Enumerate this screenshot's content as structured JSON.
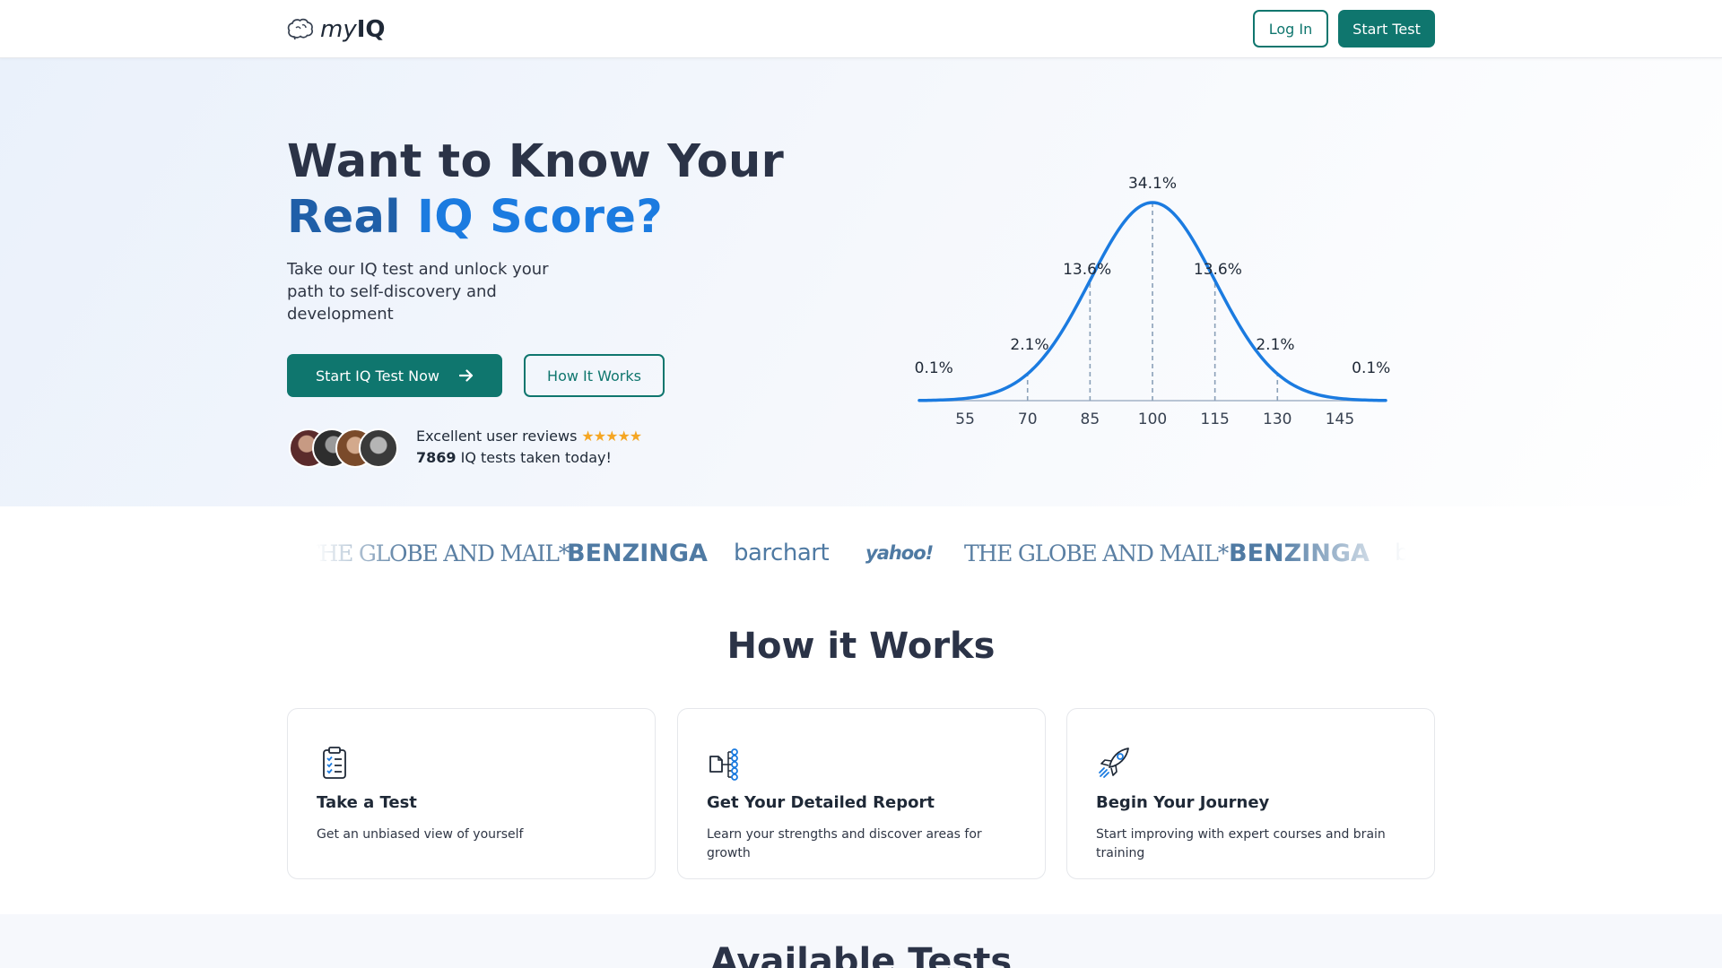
{
  "header": {
    "logo_my": "my",
    "logo_iq": "IQ",
    "login_label": "Log In",
    "start_label": "Start Test"
  },
  "hero": {
    "title_line1": "Want to Know Your",
    "title_real": "Real",
    "title_iqscore": "IQ Score?",
    "subtitle": "Take our IQ test and unlock your path to self-discovery and development",
    "primary_cta": "Start IQ Test Now",
    "secondary_cta": "How It Works",
    "reviews_text": "Excellent user reviews",
    "stars": "★★★★★",
    "rating": 5,
    "tests_count": "7869",
    "tests_text": "IQ tests taken today!"
  },
  "chart_data": {
    "type": "area",
    "x_ticks": [
      "55",
      "70",
      "85",
      "100",
      "115",
      "130",
      "145"
    ],
    "segment_labels": [
      "0.1%",
      "2.1%",
      "13.6%",
      "34.1%",
      "13.6%",
      "2.1%",
      "0.1%"
    ],
    "mean": 100,
    "sd": 15,
    "xlim": [
      44,
      156
    ],
    "dashed_lines_at": [
      70,
      85,
      100,
      115,
      130
    ],
    "color": "#1b7be0"
  },
  "press": [
    "THE GLOBE AND MAIL*",
    "BENZINGA",
    "barchart",
    "yahoo!",
    "THE GLOBE AND MAIL*",
    "BENZINGA",
    "b"
  ],
  "how_it_works": {
    "title": "How it Works",
    "cards": [
      {
        "title": "Take a Test",
        "text": "Get an unbiased view of yourself",
        "icon": "clipboard-checklist-icon"
      },
      {
        "title": "Get Your Detailed Report",
        "text": "Learn your strengths and discover areas for growth",
        "icon": "report-network-icon"
      },
      {
        "title": "Begin Your Journey",
        "text": "Start improving with expert courses and brain training",
        "icon": "rocket-icon"
      }
    ]
  },
  "available_tests": {
    "title": "Available Tests"
  },
  "colors": {
    "teal": "#0f766e",
    "blue": "#1b7be0",
    "dark": "#2b3347"
  }
}
